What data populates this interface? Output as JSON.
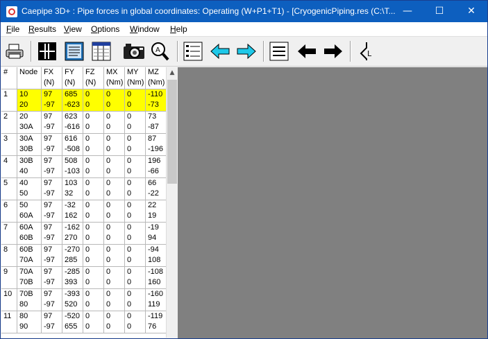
{
  "titlebar": {
    "title": "Caepipe 3D+ : Pipe forces in global coordinates: Operating (W+P1+T1) -  [CryogenicPiping.res (C:\\T...",
    "minimize": "—",
    "maximize": "☐",
    "close": "✕"
  },
  "menu": [
    "File",
    "Results",
    "View",
    "Options",
    "Window",
    "Help"
  ],
  "toolbar_icons": [
    "print-icon",
    "grid-view-icon",
    "text-view-icon",
    "table-view-icon",
    "camera-icon",
    "zoom-icon",
    "list-icon",
    "back-arrow-icon",
    "forward-arrow-icon",
    "lines-icon",
    "left-arrow-icon",
    "right-arrow-icon",
    "axis-icon"
  ],
  "table": {
    "headers": [
      {
        "l1": "#",
        "l2": ""
      },
      {
        "l1": "Node",
        "l2": ""
      },
      {
        "l1": "FX",
        "l2": "(N)"
      },
      {
        "l1": "FY",
        "l2": "(N)"
      },
      {
        "l1": "FZ",
        "l2": "(N)"
      },
      {
        "l1": "MX",
        "l2": "(Nm)"
      },
      {
        "l1": "MY",
        "l2": "(Nm)"
      },
      {
        "l1": "MZ",
        "l2": "(Nm)"
      }
    ],
    "rows": [
      {
        "num": "1",
        "node": [
          "10",
          "20"
        ],
        "fx": [
          "97",
          "-97"
        ],
        "fy": [
          "685",
          "-623"
        ],
        "fz": [
          "0",
          "0"
        ],
        "mx": [
          "0",
          "0"
        ],
        "my": [
          "0",
          "0"
        ],
        "mz": [
          "-110",
          "-73"
        ],
        "highlight": true
      },
      {
        "num": "2",
        "node": [
          "20",
          "30A"
        ],
        "fx": [
          "97",
          "-97"
        ],
        "fy": [
          "623",
          "-616"
        ],
        "fz": [
          "0",
          "0"
        ],
        "mx": [
          "0",
          "0"
        ],
        "my": [
          "0",
          "0"
        ],
        "mz": [
          "73",
          "-87"
        ]
      },
      {
        "num": "3",
        "node": [
          "30A",
          "30B"
        ],
        "fx": [
          "97",
          "-97"
        ],
        "fy": [
          "616",
          "-508"
        ],
        "fz": [
          "0",
          "0"
        ],
        "mx": [
          "0",
          "0"
        ],
        "my": [
          "0",
          "0"
        ],
        "mz": [
          "87",
          "-196"
        ]
      },
      {
        "num": "4",
        "node": [
          "30B",
          "40"
        ],
        "fx": [
          "97",
          "-97"
        ],
        "fy": [
          "508",
          "-103"
        ],
        "fz": [
          "0",
          "0"
        ],
        "mx": [
          "0",
          "0"
        ],
        "my": [
          "0",
          "0"
        ],
        "mz": [
          "196",
          "-66"
        ]
      },
      {
        "num": "5",
        "node": [
          "40",
          "50"
        ],
        "fx": [
          "97",
          "-97"
        ],
        "fy": [
          "103",
          "32"
        ],
        "fz": [
          "0",
          "0"
        ],
        "mx": [
          "0",
          "0"
        ],
        "my": [
          "0",
          "0"
        ],
        "mz": [
          "66",
          "-22"
        ]
      },
      {
        "num": "6",
        "node": [
          "50",
          "60A"
        ],
        "fx": [
          "97",
          "-97"
        ],
        "fy": [
          "-32",
          "162"
        ],
        "fz": [
          "0",
          "0"
        ],
        "mx": [
          "0",
          "0"
        ],
        "my": [
          "0",
          "0"
        ],
        "mz": [
          "22",
          "19"
        ]
      },
      {
        "num": "7",
        "node": [
          "60A",
          "60B"
        ],
        "fx": [
          "97",
          "-97"
        ],
        "fy": [
          "-162",
          "270"
        ],
        "fz": [
          "0",
          "0"
        ],
        "mx": [
          "0",
          "0"
        ],
        "my": [
          "0",
          "0"
        ],
        "mz": [
          "-19",
          "94"
        ]
      },
      {
        "num": "8",
        "node": [
          "60B",
          "70A"
        ],
        "fx": [
          "97",
          "-97"
        ],
        "fy": [
          "-270",
          "285"
        ],
        "fz": [
          "0",
          "0"
        ],
        "mx": [
          "0",
          "0"
        ],
        "my": [
          "0",
          "0"
        ],
        "mz": [
          "-94",
          "108"
        ]
      },
      {
        "num": "9",
        "node": [
          "70A",
          "70B"
        ],
        "fx": [
          "97",
          "-97"
        ],
        "fy": [
          "-285",
          "393"
        ],
        "fz": [
          "0",
          "0"
        ],
        "mx": [
          "0",
          "0"
        ],
        "my": [
          "0",
          "0"
        ],
        "mz": [
          "-108",
          "160"
        ]
      },
      {
        "num": "10",
        "node": [
          "70B",
          "80"
        ],
        "fx": [
          "97",
          "-97"
        ],
        "fy": [
          "-393",
          "520"
        ],
        "fz": [
          "0",
          "0"
        ],
        "mx": [
          "0",
          "0"
        ],
        "my": [
          "0",
          "0"
        ],
        "mz": [
          "-160",
          "119"
        ]
      },
      {
        "num": "11",
        "node": [
          "80",
          "90"
        ],
        "fx": [
          "97",
          "-97"
        ],
        "fy": [
          "-520",
          "655"
        ],
        "fz": [
          "0",
          "0"
        ],
        "mx": [
          "0",
          "0"
        ],
        "my": [
          "0",
          "0"
        ],
        "mz": [
          "-119",
          "76"
        ]
      }
    ]
  },
  "colors": {
    "highlight": "#ffff00",
    "titlebar": "#0d5fbf",
    "workspace": "#808080",
    "cyan_arrow": "#1ec8e8"
  }
}
